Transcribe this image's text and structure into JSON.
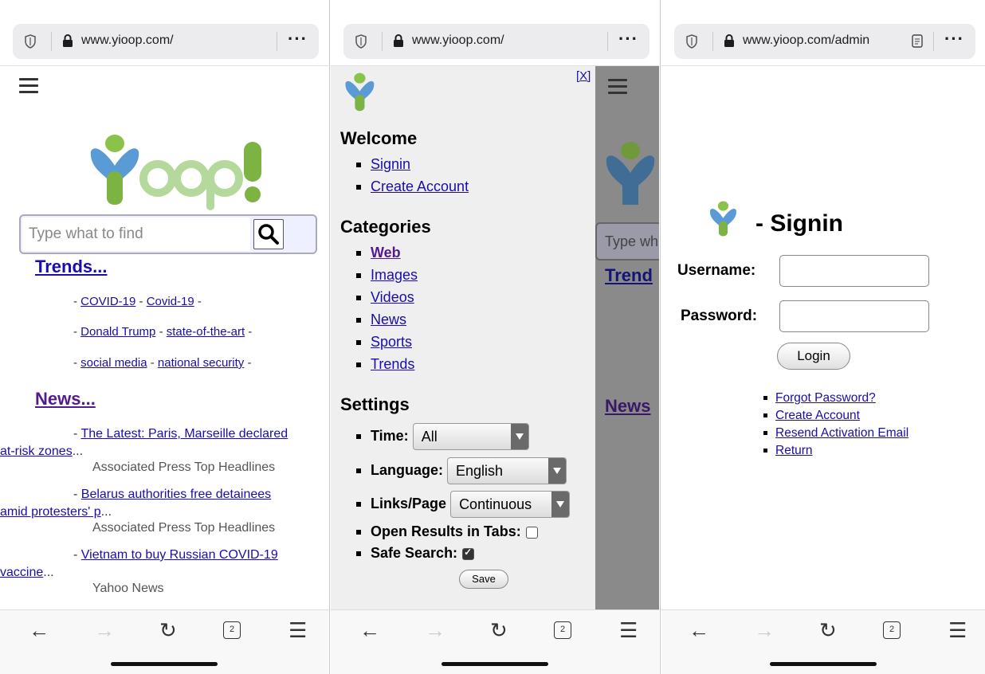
{
  "screen1": {
    "url": "www.yioop.com/",
    "search_placeholder": "Type what to find",
    "trends_heading": "Trends...",
    "trends": [
      [
        "COVID-19",
        "Covid-19"
      ],
      [
        "Donald Trump",
        "state-of-the-art"
      ],
      [
        "social media",
        "national security"
      ]
    ],
    "news_heading": "News...",
    "news": [
      {
        "line1": "The Latest: Paris, Marseille declared",
        "line2": "at-risk zones",
        "source": "Associated Press Top Headlines"
      },
      {
        "line1": "Belarus authorities free detainees",
        "line2": "amid protesters' p",
        "source": "Associated Press Top Headlines"
      },
      {
        "line1": "Vietnam to buy Russian COVID-19",
        "line2": "vaccine",
        "source": "Yahoo News"
      }
    ],
    "ellipsis": "...",
    "sep": "-",
    "tab_count": "2"
  },
  "screen2": {
    "url": "www.yioop.com/",
    "close_label": "[X]",
    "welcome_heading": "Welcome",
    "welcome_links": [
      "Signin",
      "Create Account"
    ],
    "categories_heading": "Categories",
    "categories": [
      "Web",
      "Images",
      "Videos",
      "News",
      "Sports",
      "Trends"
    ],
    "settings_heading": "Settings",
    "time_label": "Time:",
    "time_value": "All",
    "language_label": "Language:",
    "language_value": "English",
    "links_label": "Links/Page",
    "links_value": "Continuous",
    "open_tabs_label": "Open Results in Tabs:",
    "open_tabs_checked": false,
    "safe_search_label": "Safe Search:",
    "safe_search_checked": true,
    "save_label": "Save",
    "behind": {
      "search_fragment": "Type wh",
      "trends_fragment": "Trend",
      "news_fragment": "News"
    },
    "tab_count": "2"
  },
  "screen3": {
    "url": "www.yioop.com/admin",
    "title": "- Signin",
    "username_label": "Username:",
    "password_label": "Password:",
    "login_label": "Login",
    "links": [
      "Forgot Password?",
      "Create Account",
      "Resend Activation Email",
      "Return"
    ],
    "tab_count": "2"
  },
  "colors": {
    "link": "#1a0dab",
    "visited": "#551a8b",
    "logo_blue": "#5b9bd5",
    "logo_green": "#7cb342",
    "logo_lightgreen": "#b5d99c"
  }
}
